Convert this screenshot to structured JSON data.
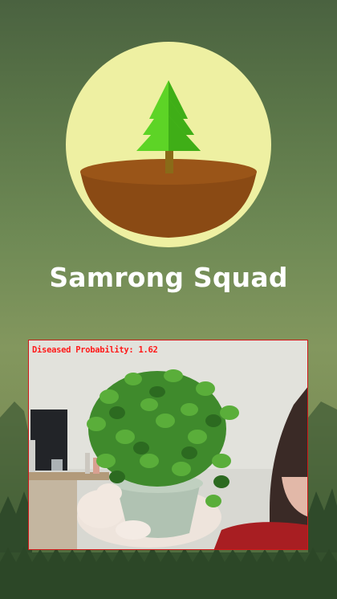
{
  "app": {
    "title": "Samrong Squad"
  },
  "logo": {
    "icon": "tree-in-pot-icon",
    "circle_color": "#eef0a2",
    "tree_color": "#47c21a",
    "soil_color": "#8a4a14"
  },
  "camera": {
    "overlay_text": "Diseased Probability: 1.62",
    "overlay_color": "#ff1a1a",
    "border_color": "#d01818"
  },
  "colors": {
    "background_top": "#4a6240",
    "background_mid": "#83975e",
    "background_bottom": "#44603a"
  }
}
